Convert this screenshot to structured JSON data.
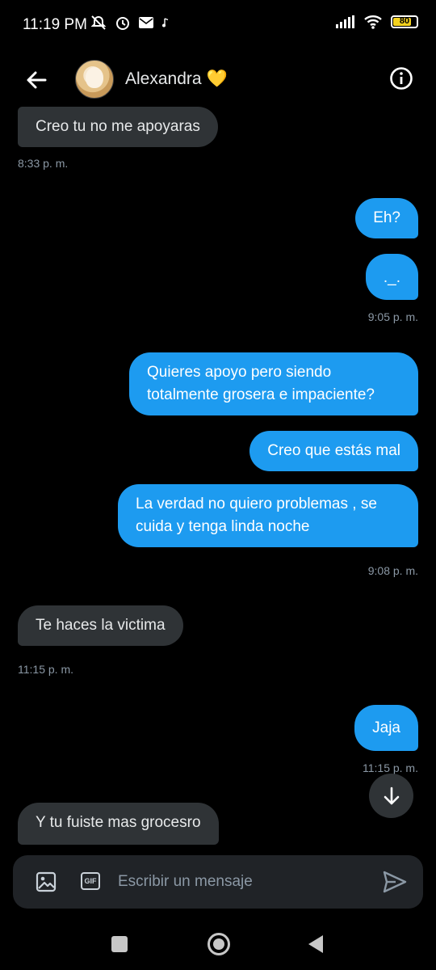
{
  "status_bar": {
    "time": "11:19 PM",
    "battery": "80",
    "battery_level": 0.8
  },
  "header": {
    "name": "Alexandra",
    "emoji": "💛"
  },
  "messages": [
    {
      "dir": "in",
      "text": "Creo tu no me apoyaras"
    },
    {
      "dir": "out",
      "text": "Eh?"
    },
    {
      "dir": "out",
      "text": "._."
    },
    {
      "dir": "out",
      "text": "Quieres apoyo pero siendo totalmente grosera e impaciente?"
    },
    {
      "dir": "out",
      "text": "Creo que estás mal"
    },
    {
      "dir": "out",
      "text": "La verdad no quiero problemas , se cuida y tenga linda noche"
    },
    {
      "dir": "in",
      "text": "Te haces la victima"
    },
    {
      "dir": "out",
      "text": "Jaja"
    },
    {
      "dir": "in",
      "text": "Y tu fuiste mas grocesro"
    }
  ],
  "timestamps": [
    "8:33 p. m.",
    "9:05 p. m.",
    "9:08 p. m.",
    "11:15 p. m.",
    "11:15 p. m."
  ],
  "composer": {
    "placeholder": "Escribir un mensaje",
    "gif_label": "GIF"
  },
  "icons": {
    "back": "back-arrow-icon",
    "info": "info-icon",
    "image": "image-icon",
    "gif": "gif-icon",
    "send": "send-icon",
    "scroll_down": "arrow-down-icon"
  },
  "colors": {
    "outgoing": "#1d9bf0",
    "incoming": "#2f3336",
    "background": "#000000"
  }
}
